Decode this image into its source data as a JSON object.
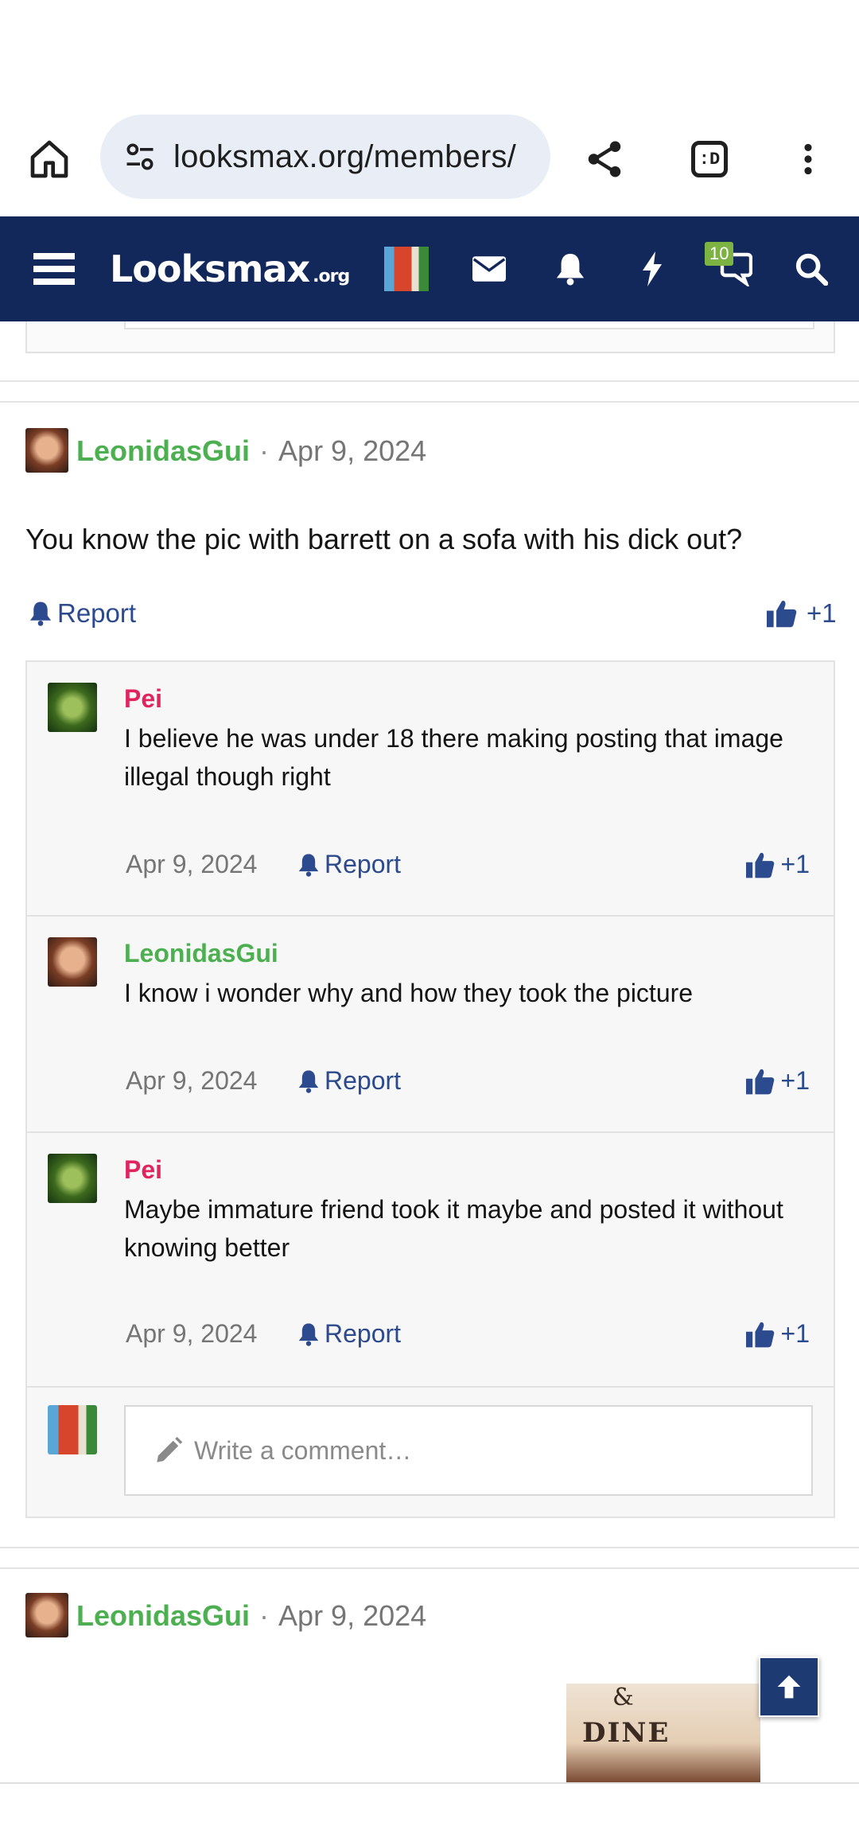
{
  "browser": {
    "url": "looksmax.org/members/",
    "tab_count_label": ":D"
  },
  "site_header": {
    "logo_main": "Looksmax",
    "logo_suffix": ".org",
    "conversations_badge": "10"
  },
  "post1": {
    "author": "LeonidasGui",
    "separator": "·",
    "date": "Apr 9, 2024",
    "body": "You know the pic with barrett on a sofa with his dick out?",
    "report_label": "Report",
    "reaction_label": "+1"
  },
  "comments": [
    {
      "author": "Pei",
      "text": "I believe he was under 18 there making posting that image illegal though right",
      "date": "Apr 9, 2024",
      "report_label": "Report",
      "reaction_label": "+1"
    },
    {
      "author": "LeonidasGui",
      "text": "I know i wonder why and how they took the picture",
      "date": "Apr 9, 2024",
      "report_label": "Report",
      "reaction_label": "+1"
    },
    {
      "author": "Pei",
      "text": "Maybe immature friend took it maybe and posted it without knowing better",
      "date": "Apr 9, 2024",
      "report_label": "Report",
      "reaction_label": "+1"
    }
  ],
  "comment_box": {
    "placeholder": "Write a comment…"
  },
  "post2": {
    "author": "LeonidasGui",
    "separator": "·",
    "date": "Apr 9, 2024",
    "image_text_amp": "&",
    "image_text_word": "DINE"
  },
  "colors": {
    "header_bg": "#13285a",
    "username_green": "#4caf50",
    "username_pink": "#e0245e",
    "link_blue": "#2c4a8e",
    "badge_green": "#7cb342"
  }
}
